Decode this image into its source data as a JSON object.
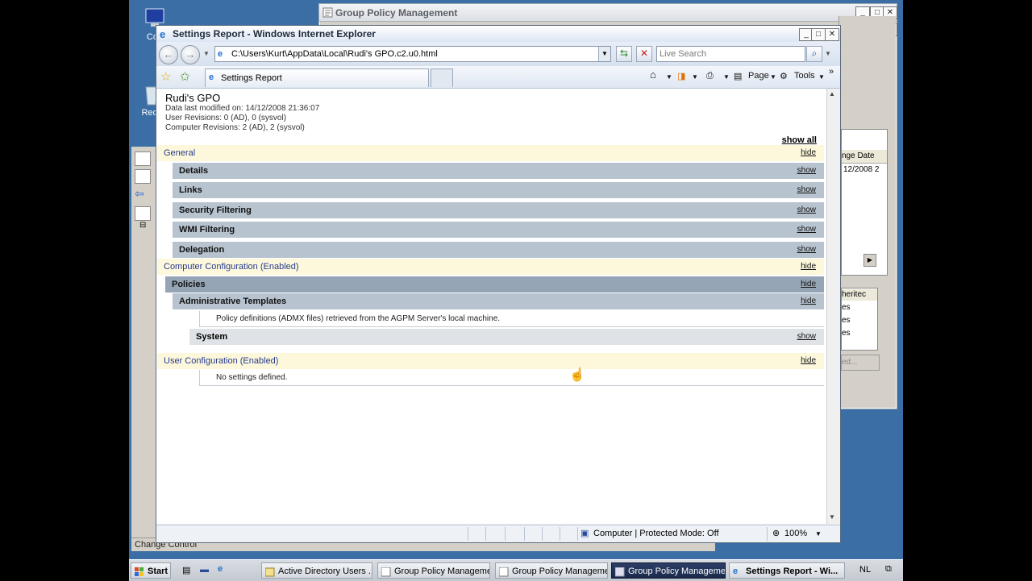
{
  "desktop": {
    "icons": [
      "Con",
      "Recy"
    ]
  },
  "gpm_window": {
    "title": "Group Policy Management",
    "right_panel": {
      "change_date_header": "nge Date",
      "change_date_value": "12/2008 2",
      "inherited_header": "heritec",
      "rows": [
        "es",
        "es",
        "es"
      ],
      "button_label": "ed..."
    },
    "status_text": "Change Control"
  },
  "ie_window": {
    "title": "Settings Report - Windows Internet Explorer",
    "address": "C:\\Users\\Kurt\\AppData\\Local\\Rudi's GPO.c2.u0.html",
    "search_placeholder": "Live Search",
    "tab_label": "Settings Report",
    "commands": {
      "page": "Page",
      "tools": "Tools"
    },
    "status": {
      "zone": "Computer | Protected Mode: Off",
      "zoom": "100%"
    }
  },
  "report": {
    "title": "Rudi's GPO",
    "meta": [
      "Data last modified on: 14/12/2008 21:36:07",
      "User Revisions: 0 (AD), 0 (sysvol)",
      "Computer Revisions: 2 (AD), 2 (sysvol)"
    ],
    "show_all": "show all",
    "general": {
      "label": "General",
      "action": "hide"
    },
    "general_items": [
      {
        "label": "Details",
        "action": "show"
      },
      {
        "label": "Links",
        "action": "show"
      },
      {
        "label": "Security Filtering",
        "action": "show"
      },
      {
        "label": "WMI Filtering",
        "action": "show"
      },
      {
        "label": "Delegation",
        "action": "show"
      }
    ],
    "computer_config": {
      "label": "Computer Configuration (Enabled)",
      "action": "hide"
    },
    "policies": {
      "label": "Policies",
      "action": "hide"
    },
    "admin_templates": {
      "label": "Administrative Templates",
      "action": "hide"
    },
    "admx_note": "Policy definitions (ADMX files) retrieved from the AGPM Server's local machine.",
    "system": {
      "label": "System",
      "action": "show"
    },
    "user_config": {
      "label": "User Configuration (Enabled)",
      "action": "hide"
    },
    "no_settings": "No settings defined."
  },
  "taskbar": {
    "start": "Start",
    "buttons": [
      "Active Directory Users ...",
      "Group Policy Management",
      "Group Policy Management",
      "Group Policy Management",
      "Settings Report - Wi..."
    ],
    "lang": "NL"
  },
  "colors": {
    "desktop": "#3a6ea5",
    "section_yellow": "#fdf8dc",
    "section_grey": "#b7c3cf",
    "section_dark": "#95a5b5",
    "link_blue": "#263a8d"
  }
}
